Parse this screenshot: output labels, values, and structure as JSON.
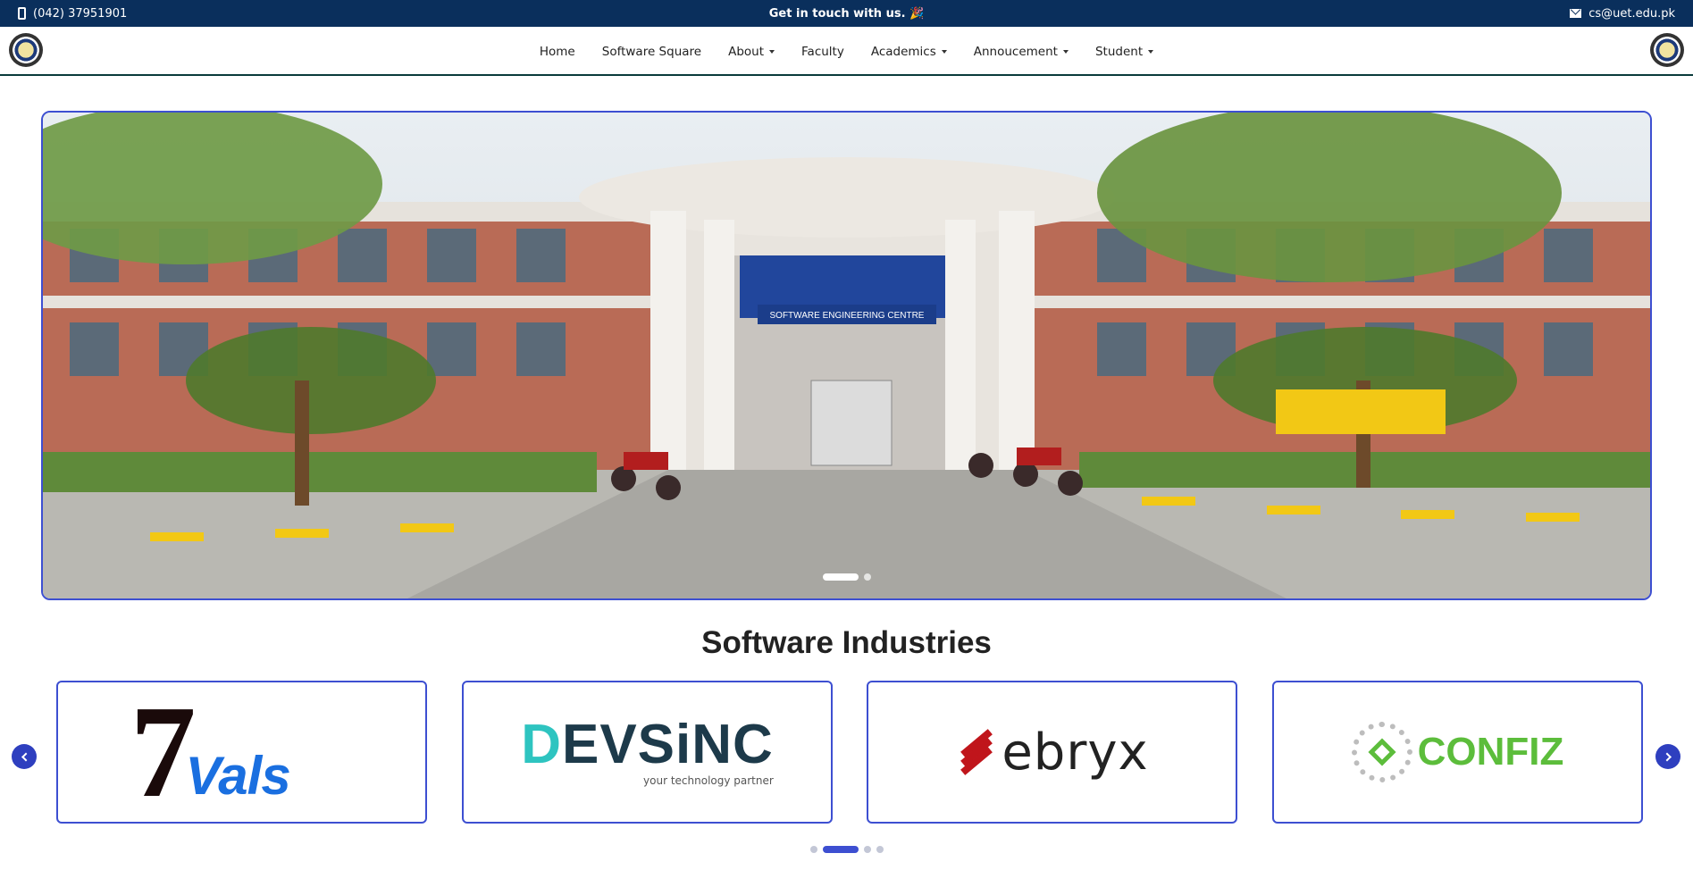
{
  "topbar": {
    "phone": "(042) 37951901",
    "message": "Get in touch with us. 🎉",
    "email": "cs@uet.edu.pk"
  },
  "nav": {
    "items": [
      {
        "label": "Home",
        "dropdown": false
      },
      {
        "label": "Software Square",
        "dropdown": false
      },
      {
        "label": "About",
        "dropdown": true
      },
      {
        "label": "Faculty",
        "dropdown": false
      },
      {
        "label": "Academics",
        "dropdown": true
      },
      {
        "label": "Annoucement",
        "dropdown": true
      },
      {
        "label": "Student",
        "dropdown": true
      }
    ]
  },
  "hero": {
    "sign_text": "SOFTWARE ENGINEERING CENTRE",
    "slide_count": 2,
    "active_slide": 0
  },
  "industries": {
    "title": "Software Industries",
    "logos": [
      {
        "seven": "7",
        "rest": "Vals"
      },
      {
        "d": "D",
        "rest": "EVSiNC",
        "tagline": "your technology partner"
      },
      {
        "name": "ebryx"
      },
      {
        "name": "CONFIZ"
      }
    ],
    "page_count": 4,
    "active_page": 1
  },
  "colors": {
    "topbar_bg": "#0a2f5c",
    "accent": "#3d4fd1",
    "devsinc_teal": "#2ec4c0",
    "ebryx_red": "#c0151b",
    "confiz_green": "#5cbd3b",
    "vals_blue": "#1a6fe0"
  }
}
